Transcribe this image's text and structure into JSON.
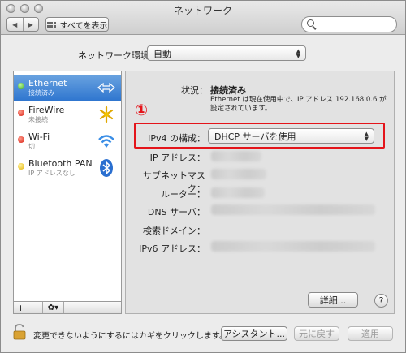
{
  "window": {
    "title": "ネットワーク"
  },
  "toolbar": {
    "back_label": "◀",
    "forward_label": "▶",
    "show_all_label": "すべてを表示",
    "search_placeholder": ""
  },
  "location": {
    "label": "ネットワーク環境：",
    "value": "自動"
  },
  "sidebar": {
    "items": [
      {
        "name": "Ethernet",
        "status": "接続済み",
        "dot": "green",
        "icon": "ethernet-arrows-icon",
        "selected": true
      },
      {
        "name": "FireWire",
        "status": "未接続",
        "dot": "red",
        "icon": "firewire-icon",
        "selected": false
      },
      {
        "name": "Wi-Fi",
        "status": "切",
        "dot": "red",
        "icon": "wifi-icon",
        "selected": false
      },
      {
        "name": "Bluetooth PAN",
        "status": "IP アドレスなし",
        "dot": "yellow",
        "icon": "bluetooth-icon",
        "selected": false
      }
    ],
    "add_label": "+",
    "remove_label": "−",
    "action_label": "✿▾"
  },
  "detail": {
    "status_label": "状況：",
    "status_value": "接続済み",
    "status_desc": "Ethernet は現在使用中で、IP アドレス 192.168.0.6 が設定されています。",
    "annotation_marker": "①",
    "ipv4_label": "IPv4 の構成：",
    "ipv4_value": "DHCP サーバを使用",
    "ip_label": "IP アドレス：",
    "subnet_label": "サブネットマスク：",
    "router_label": "ルーター：",
    "dns_label": "DNS サーバ：",
    "search_domain_label": "検索ドメイン：",
    "ipv6_label": "IPv6 アドレス：",
    "details_button": "詳細...",
    "help_button": "?"
  },
  "footer": {
    "lock_text": "変更できないようにするにはカギをクリックします。",
    "assistant_button": "アシスタント...",
    "revert_button": "元に戻す",
    "apply_button": "適用"
  },
  "colors": {
    "annotation": "#e4141a",
    "selection": "#2f76cf"
  }
}
